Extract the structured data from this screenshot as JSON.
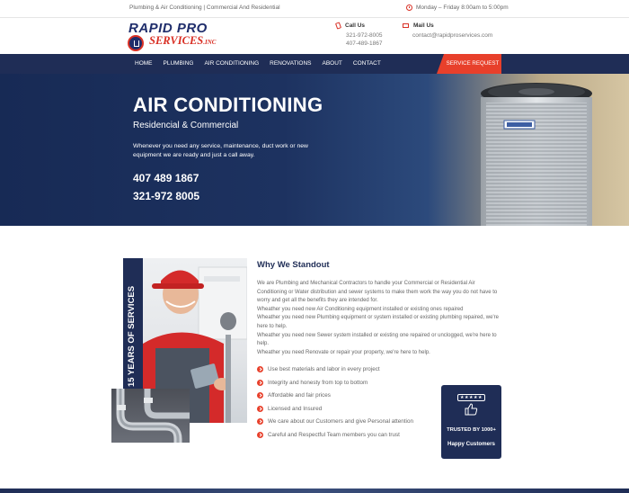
{
  "topbar": {
    "tagline": "Plumbing & Air Conditioning | Commercial And Residential",
    "hours": "Monday – Friday 8:00am to 5:00pm",
    "hours_icon": "clock-icon"
  },
  "header": {
    "logo_line1": "RAPID PRO",
    "logo_line2": "SERVICES",
    "logo_suffix": ".INC",
    "call": {
      "title": "Call Us",
      "icon": "phone-icon",
      "phone1": "321-972-8005",
      "phone2": "407-489-1867"
    },
    "mail": {
      "title": "Mail Us",
      "icon": "mail-icon",
      "email": "contact@rapidproservices.com"
    }
  },
  "nav": {
    "items": [
      "HOME",
      "PLUMBING",
      "AIR CONDITIONING",
      "RENOVATIONS",
      "ABOUT",
      "CONTACT"
    ],
    "cta": "SERVICE REQUEST"
  },
  "hero": {
    "title": "AIR CONDITIONING",
    "subtitle": "Residencial & Commercial",
    "description": "Whenever you need any service, maintenance, duct work or new equipment we are ready and just a call away.",
    "phone1": "407 489 1867",
    "phone2": "321-972 8005"
  },
  "standout": {
    "years_badge": "15 YEARS OF SERVICES",
    "title": "Why We Standout",
    "paragraphs": [
      "We are Plumbing and Mechanical Contractors to handle your Commercial or Residential Air Conditioning or Water distribution and sewer systems to make them work the way you do not have to worry and get all the benefits they are intended for.",
      "Wheather you need new Air Conditioning equipment installed or existing ones repaired",
      "Wheather you need new Plumbing equipment or system installed or existing plumbing repaired, we're here to help.",
      "Wheather you need new Sewer system installed or existing one repaired or unclogged, we're here to help.",
      "Wheather you need Renovate or repair your property, we're here to help."
    ],
    "bullets": [
      "Use best materials and labor in every project",
      "Integrity and honesty from top to bottom",
      "Affordable and fair prices",
      "Licensed and Insured",
      "We care about our Customers and give Personal attention",
      "Careful and Respectful Team members you can trust"
    ],
    "trusted": {
      "line1": "TRUSTED BY 1000+",
      "line2": "Happy Customers",
      "icon": "thumbs-up-icon"
    }
  },
  "colors": {
    "navy": "#1f2d56",
    "accent_red": "#e8402b"
  }
}
